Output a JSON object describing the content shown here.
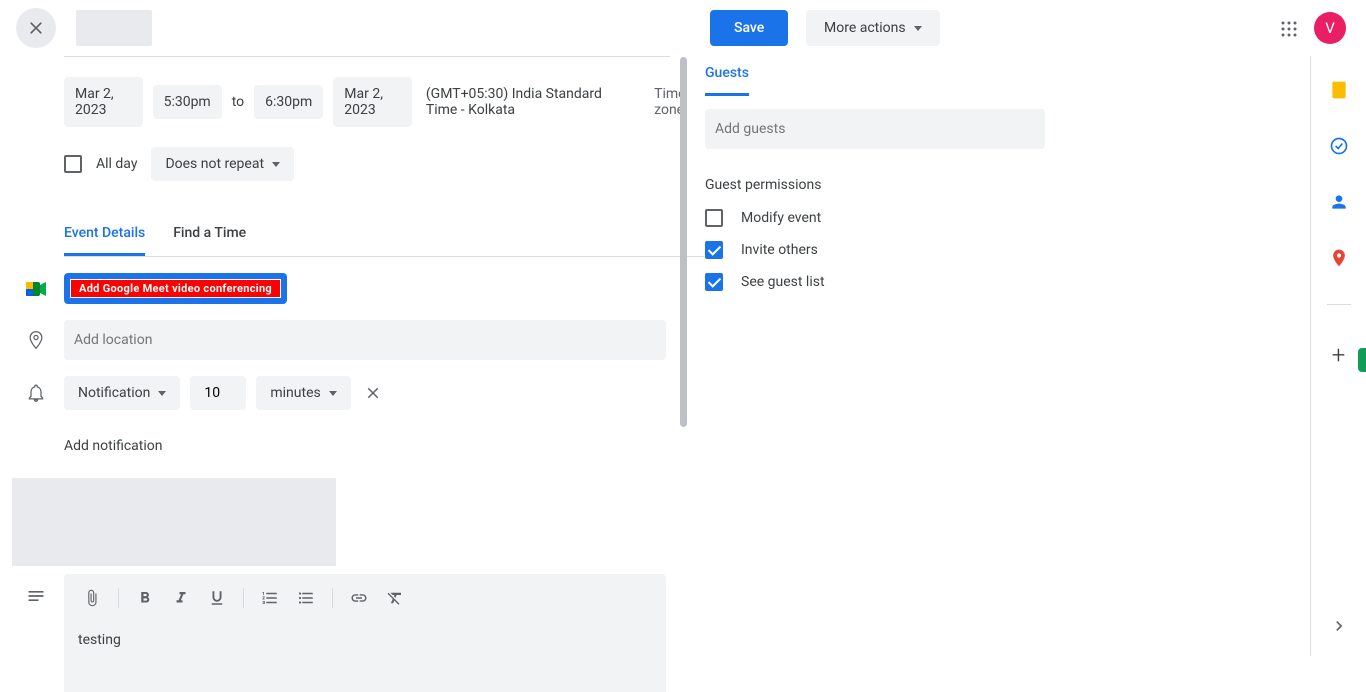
{
  "header": {
    "save": "Save",
    "more_actions": "More actions",
    "avatar_letter": "V"
  },
  "datetime": {
    "start_date": "Mar 2, 2023",
    "start_time": "5:30pm",
    "to": "to",
    "end_time": "6:30pm",
    "end_date": "Mar 2, 2023",
    "tz": "(GMT+05:30) India Standard Time - Kolkata",
    "tz_link": "Time zone"
  },
  "allday": {
    "label": "All day",
    "repeat": "Does not repeat"
  },
  "tabs": {
    "event_details": "Event Details",
    "find_time": "Find a Time"
  },
  "meet": {
    "button": "Add Google Meet video conferencing"
  },
  "location": {
    "placeholder": "Add location"
  },
  "notification": {
    "type": "Notification",
    "value": "10",
    "unit": "minutes",
    "add": "Add notification"
  },
  "description": {
    "text": "testing"
  },
  "guests": {
    "title": "Guests",
    "placeholder": "Add guests",
    "perm_title": "Guest permissions",
    "modify": "Modify event",
    "invite": "Invite others",
    "see_list": "See guest list"
  }
}
